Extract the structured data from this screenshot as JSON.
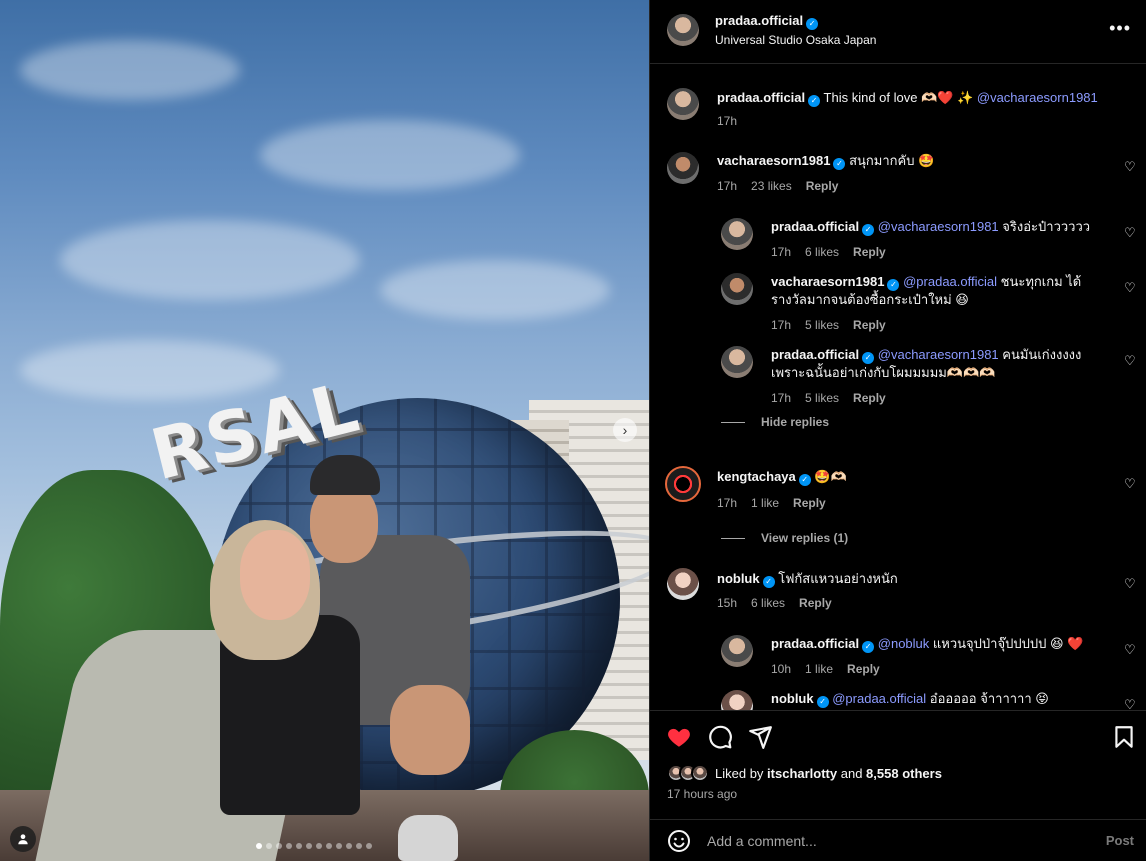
{
  "post": {
    "author": "pradaa.official",
    "location": "Universal Studio Osaka Japan",
    "sign_text": "RSAL",
    "caption": {
      "author": "pradaa.official",
      "text": "This kind of love 🫶🏻❤️ ✨",
      "mention": "@vacharaesorn1981",
      "time": "17h"
    }
  },
  "comments": [
    {
      "author": "vacharaesorn1981",
      "text": "สนุกมากคับ 🤩",
      "time": "17h",
      "likes": "23 likes",
      "reply": "Reply"
    },
    {
      "author": "pradaa.official",
      "mention": "@vacharaesorn1981",
      "text": "จริงอ่ะป๋าววววว",
      "time": "17h",
      "likes": "6 likes",
      "reply": "Reply"
    },
    {
      "author": "vacharaesorn1981",
      "mention": "@pradaa.official",
      "text": "ชนะทุกเกม ได้",
      "text2": "รางวัลมากจนต้องซื้อกระเป๋าใหม่ 😆",
      "time": "17h",
      "likes": "5 likes",
      "reply": "Reply"
    },
    {
      "author": "pradaa.official",
      "mention": "@vacharaesorn1981",
      "text": "คนมันเก่งงงงง",
      "text2": "เพราะฉนั้นอย่าเก่งกับโผมมมมม🫶🏻🫶🏻🫶🏻",
      "time": "17h",
      "likes": "5 likes",
      "reply": "Reply"
    },
    {
      "author": "kengtachaya",
      "text": "🤩🫶🏻",
      "time": "17h",
      "likes": "1 like",
      "reply": "Reply"
    },
    {
      "author": "nobluk",
      "text": "โฟกัสแหวนอย่างหนัก",
      "time": "15h",
      "likes": "6 likes",
      "reply": "Reply"
    },
    {
      "author": "pradaa.official",
      "mention": "@nobluk",
      "text": "แหวนจุปป่าจุ๊ปปปปป 😆 ❤️",
      "time": "10h",
      "likes": "1 like",
      "reply": "Reply"
    },
    {
      "author": "nobluk",
      "mention": "@pradaa.official",
      "text": "อ๋อออออ จ้าาาาาา 😝"
    }
  ],
  "toggles": {
    "hide_replies": "Hide replies",
    "view_replies": "View replies (1)"
  },
  "footer": {
    "liked_by_prefix": "Liked by ",
    "liked_by_user": "itscharlotty",
    "liked_by_mid": " and ",
    "liked_by_count": "8,558 others",
    "time_ago": "17 hours ago",
    "add_comment_placeholder": "Add a comment...",
    "post_label": "Post"
  },
  "icons": {
    "like": "heart-filled-icon",
    "comment": "comment-icon",
    "share": "share-icon",
    "save": "bookmark-icon",
    "more": "more-icon",
    "emoji": "emoji-icon"
  },
  "colors": {
    "like_red": "#ff3040",
    "mention": "#8c9bff",
    "verified": "#0095f6"
  },
  "carousel": {
    "total": 12,
    "current": 1
  }
}
